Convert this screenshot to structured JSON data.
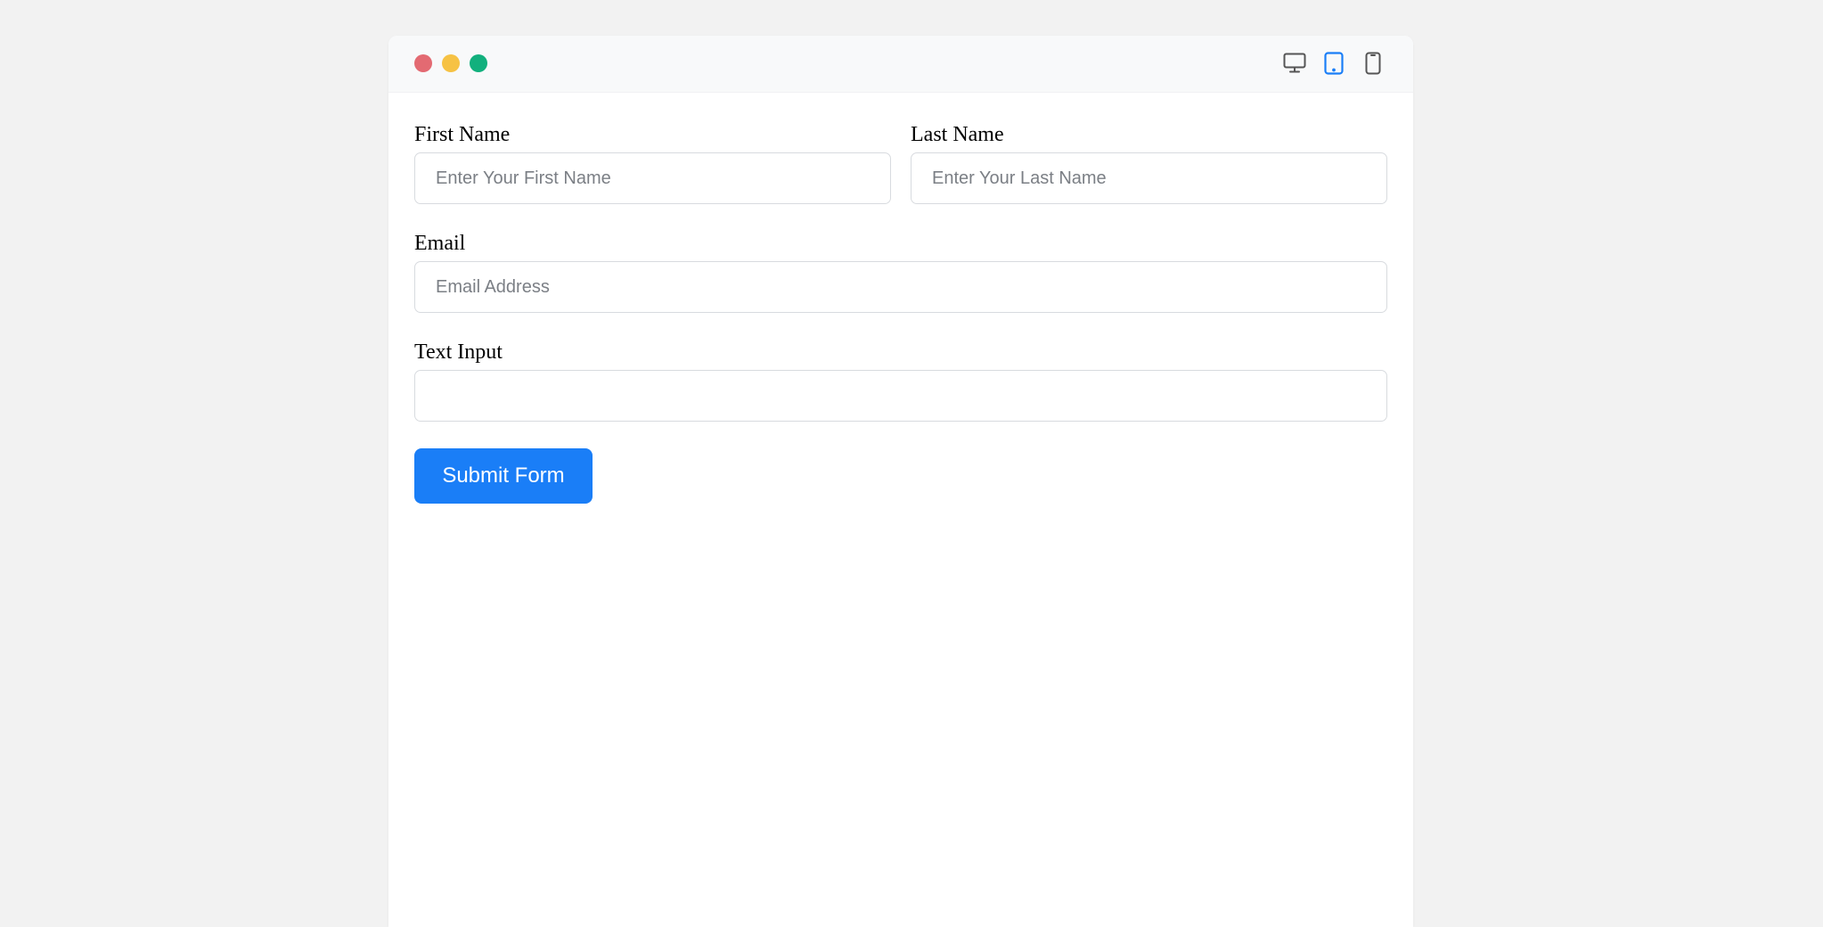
{
  "window": {
    "controls": [
      "close",
      "minimize",
      "maximize"
    ],
    "device_views": [
      {
        "name": "desktop-icon",
        "active": false
      },
      {
        "name": "tablet-icon",
        "active": true
      },
      {
        "name": "mobile-icon",
        "active": false
      }
    ],
    "colors": {
      "accent": "#1a7ef7",
      "close": "#e36a72",
      "minimize": "#f6c244",
      "maximize": "#12b07d"
    }
  },
  "form": {
    "first_name": {
      "label": "First Name",
      "placeholder": "Enter Your First Name",
      "value": ""
    },
    "last_name": {
      "label": "Last Name",
      "placeholder": "Enter Your Last Name",
      "value": ""
    },
    "email": {
      "label": "Email",
      "placeholder": "Email Address",
      "value": ""
    },
    "text_input": {
      "label": "Text Input",
      "placeholder": "",
      "value": ""
    },
    "submit_label": "Submit Form"
  }
}
